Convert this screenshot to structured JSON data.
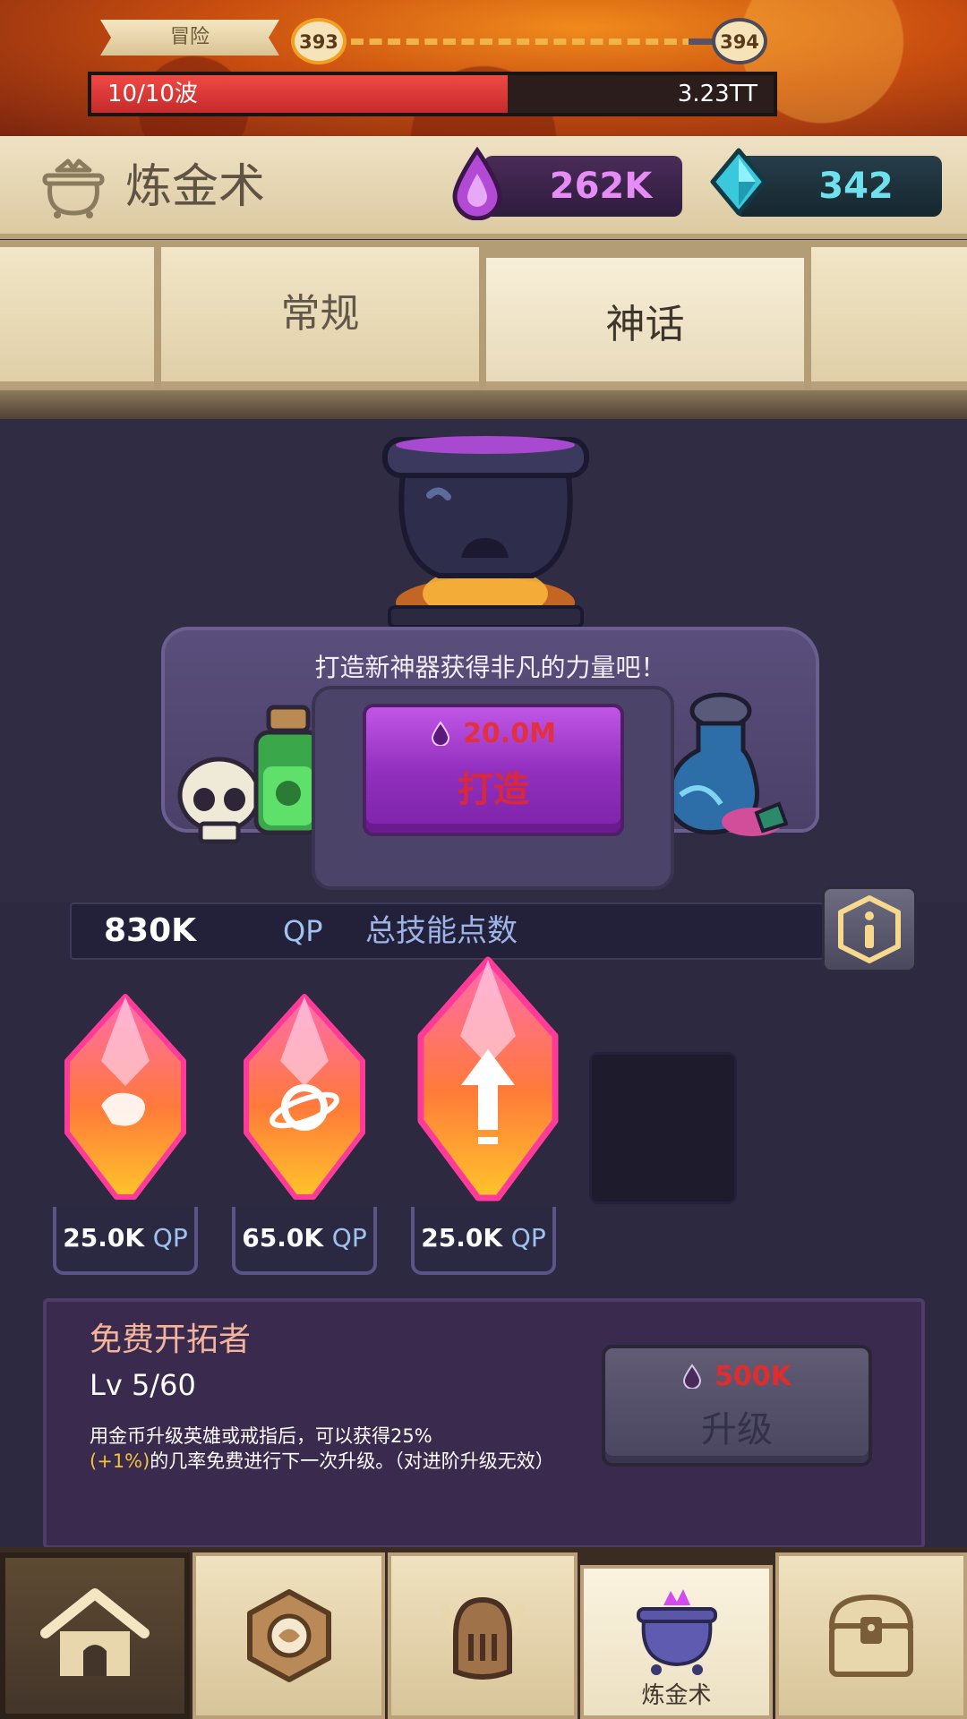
{
  "adventure": {
    "label": "冒险",
    "current_stage": "393",
    "next_stage": "394",
    "wave_text": "10/10波",
    "wave_progress": 0.61,
    "wave_value": "3.23TT"
  },
  "header": {
    "title": "炼金术",
    "elixir_amount": "262K",
    "gem_amount": "342"
  },
  "tabs": [
    {
      "label": ""
    },
    {
      "label": "常规"
    },
    {
      "label": "神话"
    },
    {
      "label": ""
    }
  ],
  "forge": {
    "caption": "打造新神器获得非凡的力量吧！",
    "cost": "20.0M",
    "button_label": "打造"
  },
  "skill_points": {
    "value": "830K",
    "unit": "QP",
    "label": "总技能点数"
  },
  "crystals": [
    {
      "price": "25.0K",
      "unit": "QP",
      "icon": "scroll-icon"
    },
    {
      "price": "65.0K",
      "unit": "QP",
      "icon": "planet-icon"
    },
    {
      "price": "25.0K",
      "unit": "QP",
      "icon": "arrow-up-icon"
    }
  ],
  "skill_detail": {
    "title": "免费开拓者",
    "level": "Lv 5/60",
    "desc_line1": "用金币升级英雄或戒指后，可以获得25%",
    "desc_hl": "(+1%)",
    "desc_line2_rest": "的几率免费进行下一次升级。（对进阶升级无效）",
    "upgrade_cost": "500K",
    "upgrade_label": "升级"
  },
  "nav": [
    {
      "icon": "home-icon",
      "label": ""
    },
    {
      "icon": "ring-icon",
      "label": ""
    },
    {
      "icon": "knight-helmet-icon",
      "label": ""
    },
    {
      "icon": "cauldron-icon",
      "label": "炼金术"
    },
    {
      "icon": "treasure-chest-icon",
      "label": ""
    }
  ],
  "colors": {
    "elixir": "#e58df5",
    "gem": "#6fe1ee",
    "cost_red": "#e02c2c",
    "forge_purple": "#9330bf"
  }
}
